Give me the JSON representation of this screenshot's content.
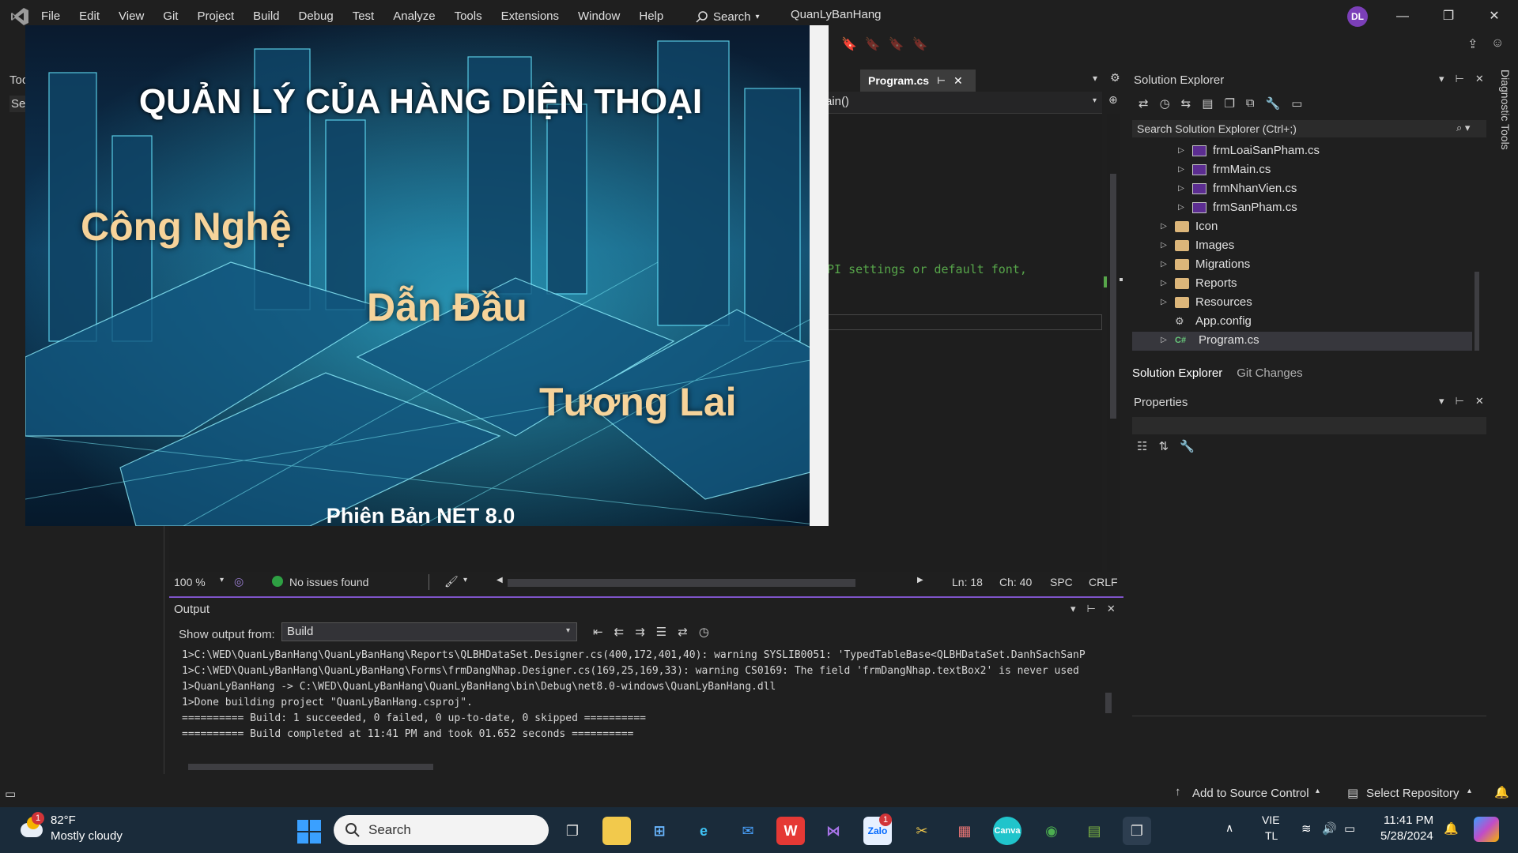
{
  "menu": [
    "File",
    "Edit",
    "View",
    "Git",
    "Project",
    "Build",
    "Debug",
    "Test",
    "Analyze",
    "Tools",
    "Extensions",
    "Window",
    "Help"
  ],
  "search_label": "Search",
  "solution_name": "QuanLyBanHang",
  "user_initials": "DL",
  "left_panel": {
    "title": "Too",
    "search_hint": "Se"
  },
  "editor": {
    "tab_label": "Program.cs",
    "nav_method": "ain()",
    "comment_fragment": "PI settings or default font,",
    "zoom": "100 %",
    "issues": "No issues found",
    "line": "Ln: 18",
    "col": "Ch: 40",
    "spacing": "SPC",
    "eol": "CRLF"
  },
  "splash": {
    "title": "QUẢN LÝ CỦA HÀNG DIỆN THOẠI",
    "word1": "Công Nghệ",
    "word2": "Dẫn Đầu",
    "word3": "Tương Lai",
    "version": "Phiên Bản NET 8.0"
  },
  "solution_explorer": {
    "title": "Solution Explorer",
    "search_placeholder": "Search Solution Explorer (Ctrl+;)",
    "items": [
      {
        "label": "frmLoaiSanPham.cs",
        "type": "form"
      },
      {
        "label": "frmMain.cs",
        "type": "form"
      },
      {
        "label": "frmNhanVien.cs",
        "type": "form"
      },
      {
        "label": "frmSanPham.cs",
        "type": "form"
      },
      {
        "label": "Icon",
        "type": "folder"
      },
      {
        "label": "Images",
        "type": "folder"
      },
      {
        "label": "Migrations",
        "type": "folder"
      },
      {
        "label": "Reports",
        "type": "folder"
      },
      {
        "label": "Resources",
        "type": "folder"
      },
      {
        "label": "App.config",
        "type": "config"
      },
      {
        "label": "Program.cs",
        "type": "cs"
      }
    ],
    "tabs": [
      "Solution Explorer",
      "Git Changes"
    ]
  },
  "properties": {
    "title": "Properties"
  },
  "output": {
    "title": "Output",
    "show_from_label": "Show output from:",
    "source": "Build",
    "lines": [
      "1>C:\\WED\\QuanLyBanHang\\QuanLyBanHang\\Reports\\QLBHDataSet.Designer.cs(400,172,401,40): warning SYSLIB0051: 'TypedTableBase<QLBHDataSet.DanhSachSanP",
      "1>C:\\WED\\QuanLyBanHang\\QuanLyBanHang\\Forms\\frmDangNhap.Designer.cs(169,25,169,33): warning CS0169: The field 'frmDangNhap.textBox2' is never used",
      "1>QuanLyBanHang -> C:\\WED\\QuanLyBanHang\\QuanLyBanHang\\bin\\Debug\\net8.0-windows\\QuanLyBanHang.dll",
      "1>Done building project \"QuanLyBanHang.csproj\".",
      "========== Build: 1 succeeded, 0 failed, 0 up-to-date, 0 skipped ==========",
      "========== Build completed at 11:41 PM and took 01.652 seconds =========="
    ]
  },
  "status_bar": {
    "source_control": "Add to Source Control",
    "repository": "Select Repository"
  },
  "side_tab": "Diagnostic Tools",
  "taskbar": {
    "weather_temp": "82°F",
    "weather_desc": "Mostly cloudy",
    "weather_badge": "1",
    "search_placeholder": "Search",
    "zalo_badge": "1",
    "lang_top": "VIE",
    "lang_bottom": "TL",
    "time": "11:41 PM",
    "date": "5/28/2024"
  },
  "colors": {
    "accent": "#7f54c9",
    "comment": "#57a64a",
    "splash_word": "#f6d39a"
  }
}
